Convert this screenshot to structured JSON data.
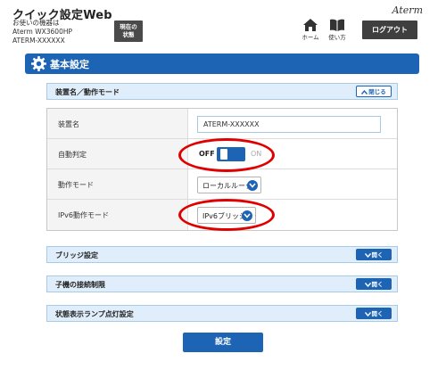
{
  "header": {
    "app_title": "クイック設定Web",
    "device_line1": "お使いの機器は",
    "device_model": "Aterm WX3600HP",
    "device_name": "ATERM-XXXXXX",
    "status_line1": "現在の",
    "status_line2": "状態",
    "brand": "Aterm",
    "home_label": "ホーム",
    "manual_label": "使い方",
    "logout_label": "ログアウト"
  },
  "section": {
    "title": "基本設定"
  },
  "panels": {
    "device_mode": {
      "label": "装置名／動作モード",
      "toggle": "閉じる"
    },
    "bridge": {
      "label": "ブリッジ設定",
      "toggle": "開く"
    },
    "client_limit": {
      "label": "子機の接続制限",
      "toggle": "開く"
    },
    "lamp": {
      "label": "状態表示ランプ点灯設定",
      "toggle": "開く"
    }
  },
  "fields": {
    "device_name_label": "装置名",
    "device_name_value": "ATERM-XXXXXX",
    "auto_detect_label": "自動判定",
    "auto_detect_off": "OFF",
    "auto_detect_on": "ON",
    "auto_detect_state": "OFF",
    "mode_label": "動作モード",
    "mode_value": "ローカルルータ",
    "ipv6_label": "IPv6動作モード",
    "ipv6_value": "IPv6ブリッジ"
  },
  "submit_label": "設定",
  "colors": {
    "accent": "#1e64b4",
    "highlight": "#e00000"
  }
}
